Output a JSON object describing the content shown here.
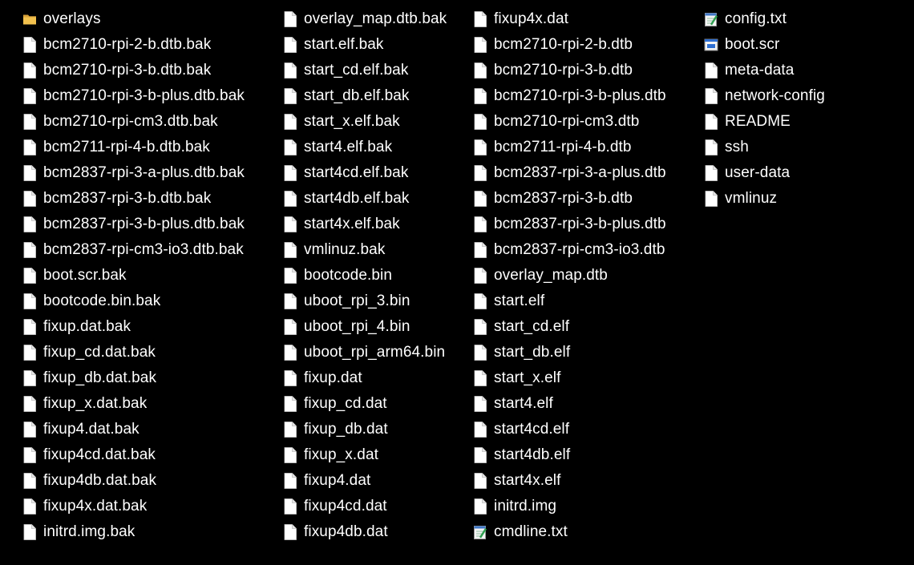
{
  "columns": [
    {
      "items": [
        {
          "name": "overlays",
          "icon": "folder-icon"
        },
        {
          "name": "bcm2710-rpi-2-b.dtb.bak",
          "icon": "file-icon"
        },
        {
          "name": "bcm2710-rpi-3-b.dtb.bak",
          "icon": "file-icon"
        },
        {
          "name": "bcm2710-rpi-3-b-plus.dtb.bak",
          "icon": "file-icon"
        },
        {
          "name": "bcm2710-rpi-cm3.dtb.bak",
          "icon": "file-icon"
        },
        {
          "name": "bcm2711-rpi-4-b.dtb.bak",
          "icon": "file-icon"
        },
        {
          "name": "bcm2837-rpi-3-a-plus.dtb.bak",
          "icon": "file-icon"
        },
        {
          "name": "bcm2837-rpi-3-b.dtb.bak",
          "icon": "file-icon"
        },
        {
          "name": "bcm2837-rpi-3-b-plus.dtb.bak",
          "icon": "file-icon"
        },
        {
          "name": "bcm2837-rpi-cm3-io3.dtb.bak",
          "icon": "file-icon"
        },
        {
          "name": "boot.scr.bak",
          "icon": "file-icon"
        },
        {
          "name": "bootcode.bin.bak",
          "icon": "file-icon"
        },
        {
          "name": "fixup.dat.bak",
          "icon": "file-icon"
        },
        {
          "name": "fixup_cd.dat.bak",
          "icon": "file-icon"
        },
        {
          "name": "fixup_db.dat.bak",
          "icon": "file-icon"
        },
        {
          "name": "fixup_x.dat.bak",
          "icon": "file-icon"
        },
        {
          "name": "fixup4.dat.bak",
          "icon": "file-icon"
        },
        {
          "name": "fixup4cd.dat.bak",
          "icon": "file-icon"
        },
        {
          "name": "fixup4db.dat.bak",
          "icon": "file-icon"
        },
        {
          "name": "fixup4x.dat.bak",
          "icon": "file-icon"
        },
        {
          "name": "initrd.img.bak",
          "icon": "file-icon"
        }
      ]
    },
    {
      "items": [
        {
          "name": "overlay_map.dtb.bak",
          "icon": "file-icon"
        },
        {
          "name": "start.elf.bak",
          "icon": "file-icon"
        },
        {
          "name": "start_cd.elf.bak",
          "icon": "file-icon"
        },
        {
          "name": "start_db.elf.bak",
          "icon": "file-icon"
        },
        {
          "name": "start_x.elf.bak",
          "icon": "file-icon"
        },
        {
          "name": "start4.elf.bak",
          "icon": "file-icon"
        },
        {
          "name": "start4cd.elf.bak",
          "icon": "file-icon"
        },
        {
          "name": "start4db.elf.bak",
          "icon": "file-icon"
        },
        {
          "name": "start4x.elf.bak",
          "icon": "file-icon"
        },
        {
          "name": "vmlinuz.bak",
          "icon": "file-icon"
        },
        {
          "name": "bootcode.bin",
          "icon": "file-icon"
        },
        {
          "name": "uboot_rpi_3.bin",
          "icon": "file-icon"
        },
        {
          "name": "uboot_rpi_4.bin",
          "icon": "file-icon"
        },
        {
          "name": "uboot_rpi_arm64.bin",
          "icon": "file-icon"
        },
        {
          "name": "fixup.dat",
          "icon": "file-icon"
        },
        {
          "name": "fixup_cd.dat",
          "icon": "file-icon"
        },
        {
          "name": "fixup_db.dat",
          "icon": "file-icon"
        },
        {
          "name": "fixup_x.dat",
          "icon": "file-icon"
        },
        {
          "name": "fixup4.dat",
          "icon": "file-icon"
        },
        {
          "name": "fixup4cd.dat",
          "icon": "file-icon"
        },
        {
          "name": "fixup4db.dat",
          "icon": "file-icon"
        }
      ]
    },
    {
      "items": [
        {
          "name": "fixup4x.dat",
          "icon": "file-icon"
        },
        {
          "name": "bcm2710-rpi-2-b.dtb",
          "icon": "file-icon"
        },
        {
          "name": "bcm2710-rpi-3-b.dtb",
          "icon": "file-icon"
        },
        {
          "name": "bcm2710-rpi-3-b-plus.dtb",
          "icon": "file-icon"
        },
        {
          "name": "bcm2710-rpi-cm3.dtb",
          "icon": "file-icon"
        },
        {
          "name": "bcm2711-rpi-4-b.dtb",
          "icon": "file-icon"
        },
        {
          "name": "bcm2837-rpi-3-a-plus.dtb",
          "icon": "file-icon"
        },
        {
          "name": "bcm2837-rpi-3-b.dtb",
          "icon": "file-icon"
        },
        {
          "name": "bcm2837-rpi-3-b-plus.dtb",
          "icon": "file-icon"
        },
        {
          "name": "bcm2837-rpi-cm3-io3.dtb",
          "icon": "file-icon"
        },
        {
          "name": "overlay_map.dtb",
          "icon": "file-icon"
        },
        {
          "name": "start.elf",
          "icon": "file-icon"
        },
        {
          "name": "start_cd.elf",
          "icon": "file-icon"
        },
        {
          "name": "start_db.elf",
          "icon": "file-icon"
        },
        {
          "name": "start_x.elf",
          "icon": "file-icon"
        },
        {
          "name": "start4.elf",
          "icon": "file-icon"
        },
        {
          "name": "start4cd.elf",
          "icon": "file-icon"
        },
        {
          "name": "start4db.elf",
          "icon": "file-icon"
        },
        {
          "name": "start4x.elf",
          "icon": "file-icon"
        },
        {
          "name": "initrd.img",
          "icon": "file-icon"
        },
        {
          "name": "cmdline.txt",
          "icon": "notepad-icon"
        }
      ]
    },
    {
      "items": [
        {
          "name": "config.txt",
          "icon": "notepad-icon"
        },
        {
          "name": "boot.scr",
          "icon": "script-file-icon"
        },
        {
          "name": "meta-data",
          "icon": "file-icon"
        },
        {
          "name": "network-config",
          "icon": "file-icon"
        },
        {
          "name": "README",
          "icon": "file-icon"
        },
        {
          "name": "ssh",
          "icon": "file-icon"
        },
        {
          "name": "user-data",
          "icon": "file-icon"
        },
        {
          "name": "vmlinuz",
          "icon": "file-icon"
        }
      ]
    }
  ],
  "colors": {
    "background": "#000000",
    "text": "#ffffff",
    "folder": "#f2c14e",
    "file": "#ffffff",
    "notepad_accent": "#2e9e4f",
    "script_accent": "#2f6fd1"
  }
}
